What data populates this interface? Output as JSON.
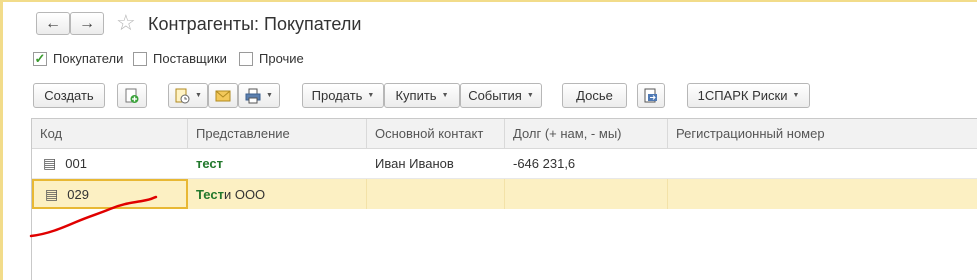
{
  "window": {
    "title": "Контрагенты: Покупатели"
  },
  "nav": {
    "back_glyph": "←",
    "forward_glyph": "→",
    "favorite_glyph": "☆"
  },
  "filters": [
    {
      "label": "Покупатели",
      "checked": true
    },
    {
      "label": "Поставщики",
      "checked": false
    },
    {
      "label": "Прочие",
      "checked": false
    }
  ],
  "toolbar": {
    "create": "Создать",
    "sell": "Продать",
    "buy": "Купить",
    "events": "События",
    "dossier": "Досье",
    "spark": "1СПАРК Риски"
  },
  "table": {
    "columns": [
      "Код",
      "Представление",
      "Основной контакт",
      "Долг (+ нам, - мы)",
      "Регистрационный номер"
    ],
    "rows": [
      {
        "code": "001",
        "name": "тест",
        "contact": "Иван Иванов",
        "debt": "-646 231,6",
        "reg": ""
      },
      {
        "code": "029",
        "name_highlight": "Тест",
        "name_rest": "и ООО",
        "contact": "",
        "debt": "",
        "reg": ""
      }
    ]
  },
  "colors": {
    "accent_yellow": "#f2dc8a",
    "selection": "#fcf0c3",
    "selection_border": "#e8b834",
    "green": "#22782c",
    "annotation_red": "#e00000"
  }
}
